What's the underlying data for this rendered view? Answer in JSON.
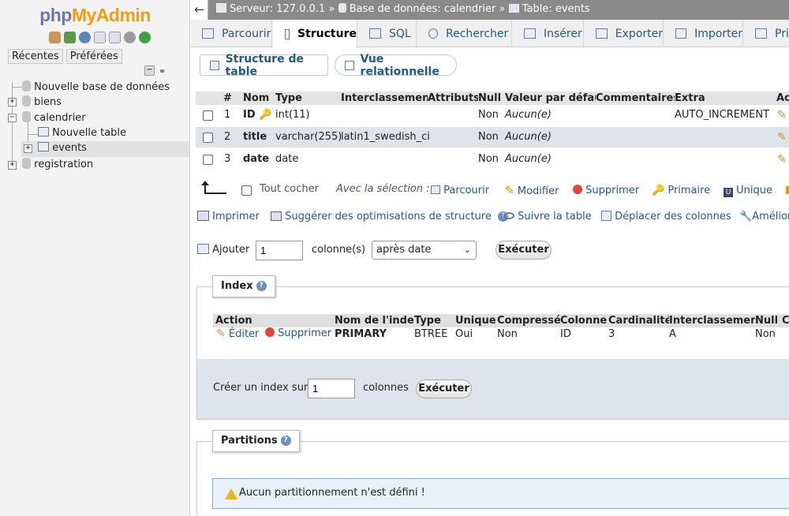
{
  "sidebar": {
    "logo_part1": "php",
    "logo_part2": "MyAdmin",
    "tabs": [
      "Récentes",
      "Préférées"
    ],
    "tree": {
      "new_db": "Nouvelle base de données",
      "db1": "biens",
      "db2": "calendrier",
      "new_table": "Nouvelle table",
      "table_events": "events",
      "db3": "registration"
    }
  },
  "topbar": {
    "back": "←",
    "server": "Serveur: 127.0.0.1",
    "sep1": "»",
    "database": "Base de données: calendrier",
    "sep2": "»",
    "table": "Table: events"
  },
  "main_tabs": [
    "Parcourir",
    "Structure",
    "SQL",
    "Rechercher",
    "Insérer",
    "Exporter",
    "Importer",
    "Pri"
  ],
  "sub_tabs": [
    "Structure de table",
    "Vue relationnelle"
  ],
  "structure": {
    "headers": [
      "#",
      "Nom",
      "Type",
      "Interclassement",
      "Attributs",
      "Null",
      "Valeur par défaut",
      "Commentaires",
      "Extra",
      "Ac"
    ],
    "rows": [
      {
        "num": "1",
        "name": "ID",
        "type": "int(11)",
        "collation": "",
        "null": "Non",
        "default": "Aucun(e)",
        "extra": "AUTO_INCREMENT"
      },
      {
        "num": "2",
        "name": "title",
        "type": "varchar(255)",
        "collation": "latin1_swedish_ci",
        "null": "Non",
        "default": "Aucun(e)",
        "extra": ""
      },
      {
        "num": "3",
        "name": "date",
        "type": "date",
        "collation": "",
        "null": "Non",
        "default": "Aucun(e)",
        "extra": ""
      }
    ]
  },
  "selection_bar": {
    "check_all": "Tout cocher",
    "with_selection": "Avec la sélection :",
    "actions": [
      "Parcourir",
      "Modifier",
      "Supprimer",
      "Primaire",
      "Unique"
    ]
  },
  "tools": [
    "Imprimer",
    "Suggérer des optimisations de structure",
    "Suivre la table",
    "Déplacer des colonnes",
    "Amélior"
  ],
  "add_columns": {
    "label": "Ajouter",
    "value": "1",
    "unit": "colonne(s)",
    "position": "après date",
    "execute": "Exécuter"
  },
  "index": {
    "legend": "Index",
    "help": "?",
    "headers": [
      "Action",
      "Nom de l'index",
      "Type",
      "Unique",
      "Compressé",
      "Colonne",
      "Cardinalité",
      "Interclassement",
      "Null",
      "C"
    ],
    "row": {
      "edit": "Éditer",
      "delete": "Supprimer",
      "name": "PRIMARY",
      "type": "BTREE",
      "unique": "Oui",
      "packed": "Non",
      "column": "ID",
      "cardinality": "3",
      "collation": "A",
      "null": "Non"
    },
    "create_label": "Créer un index sur",
    "create_value": "1",
    "create_unit": "colonnes",
    "execute": "Exécuter"
  },
  "partitions": {
    "legend": "Partitions",
    "help": "?",
    "message": "Aucun partitionnement n'est défini !"
  },
  "colors": {
    "link": "#235a81",
    "topbar": "#8a8a8a",
    "logo_php": "#6c78af",
    "logo_admin": "#f89c0e"
  }
}
